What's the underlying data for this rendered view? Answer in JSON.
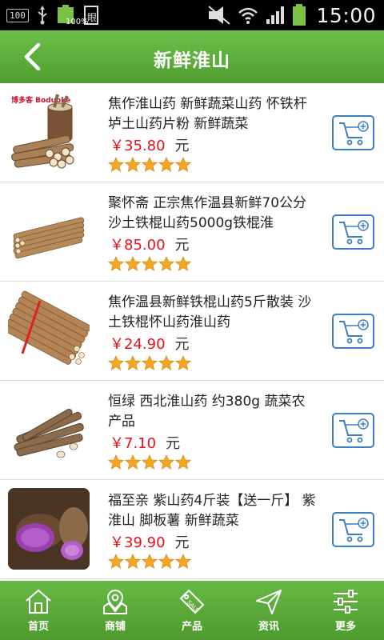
{
  "status_bar": {
    "left_badge": "100",
    "battery_percent": "100%",
    "time": "15:00"
  },
  "header": {
    "title": "新鲜淮山",
    "back_icon": "chevron-left-icon"
  },
  "products": [
    {
      "title": "焦作淮山药 新鲜蔬菜山药 怀铁杆垆土山药片粉 新鲜蔬菜",
      "price": "￥35.80",
      "unit": "元",
      "rating": 5,
      "thumb_label": "博多客 Boduoke"
    },
    {
      "title": "聚怀斋 正宗焦作温县新鲜70公分沙土铁棍山药5000g铁棍淮",
      "price": "￥85.00",
      "unit": "元",
      "rating": 5
    },
    {
      "title": "焦作温县新鲜铁棍山药5斤散装 沙土铁棍怀山药淮山药",
      "price": "￥24.90",
      "unit": "元",
      "rating": 5
    },
    {
      "title": "恒绿 西北淮山药 约380g 蔬菜农产品",
      "price": "￥7.10",
      "unit": "元",
      "rating": 5
    },
    {
      "title": "福至亲 紫山药4斤装【送一斤】 紫淮山 脚板薯 新鲜蔬菜",
      "price": "￥39.90",
      "unit": "元",
      "rating": 5
    }
  ],
  "bottom_nav": [
    {
      "label": "首页",
      "icon": "home-icon"
    },
    {
      "label": "商铺",
      "icon": "store-icon"
    },
    {
      "label": "产品",
      "icon": "tag-icon"
    },
    {
      "label": "资讯",
      "icon": "send-icon"
    },
    {
      "label": "更多",
      "icon": "sliders-icon"
    }
  ],
  "colors": {
    "header_green": "#5aae3a",
    "price_red": "#e8101a",
    "cart_blue": "#3c7fc2",
    "star_orange": "#f5a623"
  }
}
